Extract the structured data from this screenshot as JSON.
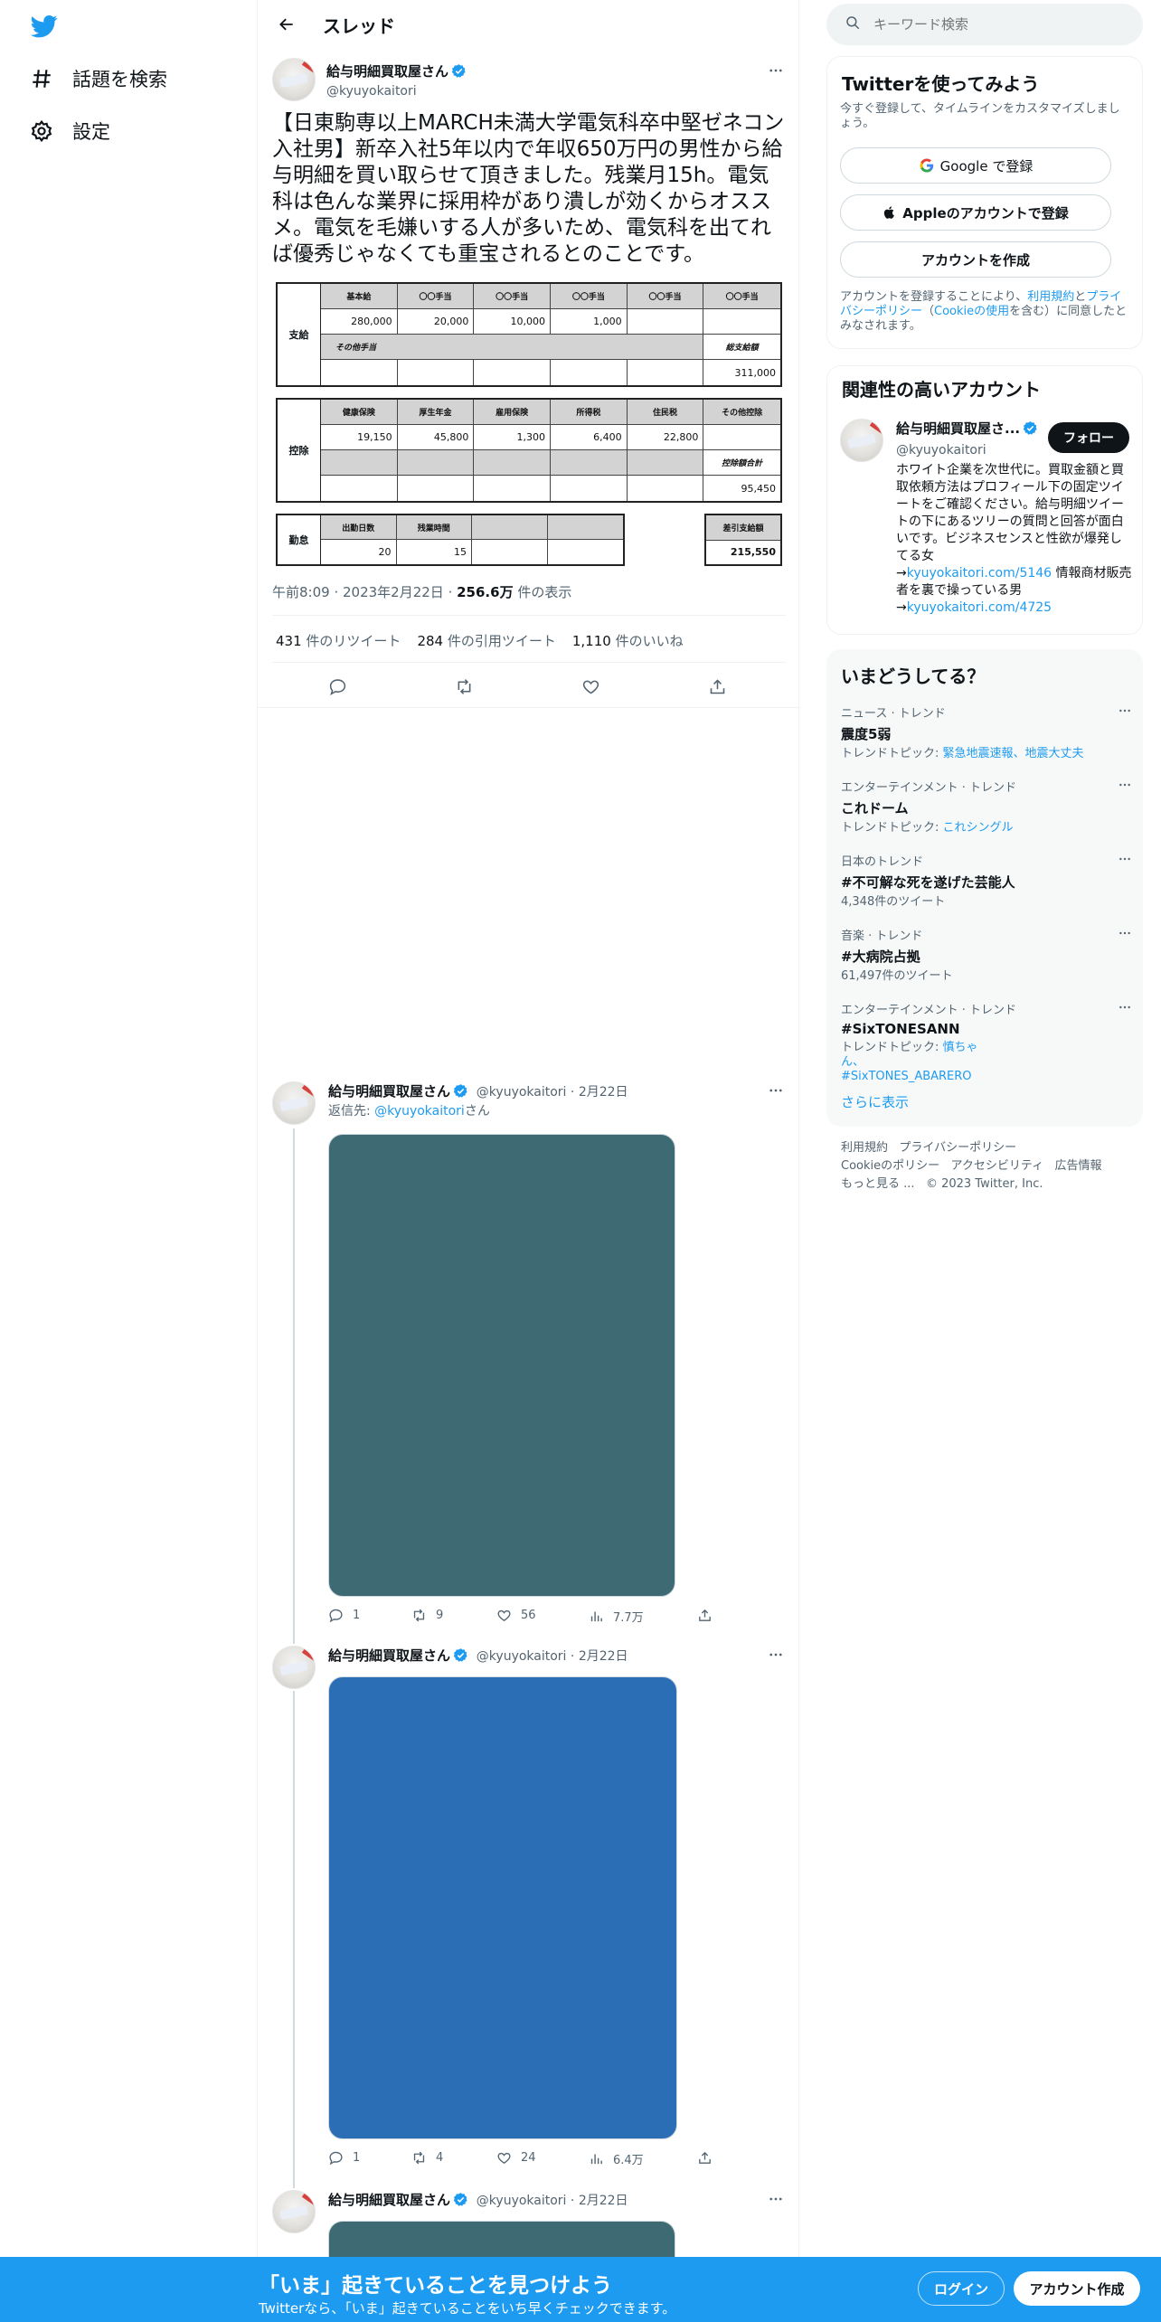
{
  "nav": {
    "explore_label": "話題を検索",
    "settings_label": "設定"
  },
  "header": {
    "title": "スレッド"
  },
  "main_tweet": {
    "author_name": "給与明細買取屋さん",
    "author_handle": "@kyuyokaitori",
    "text": "【日東駒専以上MARCH未満大学電気科卒中堅ゼネコン入社男】新卒入社5年以内で年収650万円の男性から給与明細を買い取らせて頂きました。残業月15h。電気科は色んな業界に採用枠があり潰しが効くからオススメ。電気を毛嫌いする人が多いため、電気科を出てれば優秀じゃなくても重宝されるとのことです。",
    "time": "午前8:09",
    "date": "2023年2月22日",
    "views_value": "256.6万",
    "views_label": "件の表示",
    "retweets_value": "431",
    "retweets_label": "件のリツイート",
    "quotes_value": "284",
    "quotes_label": "件の引用ツイート",
    "likes_value": "1,110",
    "likes_label": "件のいいね"
  },
  "payslip": {
    "pay": {
      "section": "支給",
      "headers": [
        "基本給",
        "〇〇手当",
        "〇〇手当",
        "〇〇手当",
        "〇〇手当",
        "〇〇手当"
      ],
      "values": [
        "280,000",
        "20,000",
        "10,000",
        "1,000",
        "",
        ""
      ],
      "other_label": "その他手当",
      "total_label": "総支給額",
      "total_value": "311,000"
    },
    "deduct": {
      "section": "控除",
      "headers": [
        "健康保険",
        "厚生年金",
        "雇用保険",
        "所得税",
        "住民税",
        "その他控除"
      ],
      "values": [
        "19,150",
        "45,800",
        "1,300",
        "6,400",
        "22,800",
        ""
      ],
      "total_label": "控除額合計",
      "total_value": "95,450"
    },
    "attend": {
      "section": "勤怠",
      "headers": [
        "出勤日数",
        "残業時間"
      ],
      "values": [
        "20",
        "15"
      ],
      "net_label": "差引支給額",
      "net_value": "215,550"
    }
  },
  "replies": [
    {
      "author_name": "給与明細買取屋さん",
      "handle": "@kyuyokaitori",
      "date": "2月22日",
      "replying_prefix": "返信先: ",
      "replying_to": "@kyuyokaitori",
      "replying_suffix": "さん",
      "media_color": "#3e6b73",
      "replies": "1",
      "retweets": "9",
      "likes": "56",
      "views": "7.7万"
    },
    {
      "author_name": "給与明細買取屋さん",
      "handle": "@kyuyokaitori",
      "date": "2月22日",
      "media_color": "#2c6eb5",
      "replies": "1",
      "retweets": "4",
      "likes": "24",
      "views": "6.4万"
    },
    {
      "author_name": "給与明細買取屋さん",
      "handle": "@kyuyokaitori",
      "date": "2月22日",
      "media_color": "#3e6b73"
    }
  ],
  "search": {
    "placeholder": "キーワード検索"
  },
  "signup_card": {
    "title": "Twitterを使ってみよう",
    "desc": "今すぐ登録して、タイムラインをカスタマイズしましょう。",
    "google": "Google で登録",
    "apple": "Appleのアカウントで登録",
    "create": "アカウントを作成",
    "terms_pre": "アカウントを登録することにより、",
    "terms_link": "利用規約",
    "terms_mid": "と",
    "privacy_link": "プライバシーポリシー",
    "terms_mid2": "（",
    "cookie_link": "Cookieの使用",
    "terms_post": "を含む）に同意したとみなされます。"
  },
  "related": {
    "title": "関連性の高いアカウント",
    "name": "給与明細買取屋さ...",
    "handle": "@kyuyokaitori",
    "follow": "フォロー",
    "bio_1": "ホワイト企業を次世代に。買取金額と買取依頼方法はプロフィール下の固定ツイートをご確認ください。給与明細ツイートの下にあるツリーの質問と回答が面白いです。ビジネスセンスと性欲が爆発してる女",
    "arrow_1": "→",
    "link_1": "kyuyokaitori.com/5146",
    "bio_2": " 情報商材販売者を裏で操っている男",
    "arrow_2": "→",
    "link_2": "kyuyokaitori.com/4725"
  },
  "trends": {
    "title": "いまどうしてる？",
    "items": [
      {
        "cat": "ニュース · トレンド",
        "name": "震度5弱",
        "sub_prefix": "トレンドトピック: ",
        "sub_links": "緊急地震速報、地震大丈夫"
      },
      {
        "cat": "エンターテインメント · トレンド",
        "name": "これドーム",
        "sub_prefix": "トレンドトピック: ",
        "sub_links": "これシングル"
      },
      {
        "cat": "日本のトレンド",
        "name": "#不可解な死を遂げた芸能人",
        "sub_plain": "4,348件のツイート"
      },
      {
        "cat": "音楽 · トレンド",
        "name": "#大病院占拠",
        "sub_plain": "61,497件のツイート"
      },
      {
        "cat": "エンターテインメント · トレンド",
        "name": "#SixTONESANN",
        "sub_prefix": "トレンドトピック: ",
        "sub_links": "慎ちゃん、#SixTONES_ABARERO"
      }
    ],
    "show_more": "さらに表示"
  },
  "footer": {
    "links": [
      "利用規約",
      "プライバシーポリシー",
      "Cookieのポリシー",
      "アクセシビリティ",
      "広告情報",
      "もっと見る ..."
    ],
    "copyright": "© 2023 Twitter, Inc."
  },
  "banner": {
    "title": "「いま」起きていることを見つけよう",
    "sub": "Twitterなら、「いま」起きていることをいち早くチェックできます。",
    "login": "ログイン",
    "signup": "アカウント作成"
  },
  "colors": {
    "accent": "#1d9bf0",
    "text": "#0f1419",
    "muted": "#536471"
  }
}
